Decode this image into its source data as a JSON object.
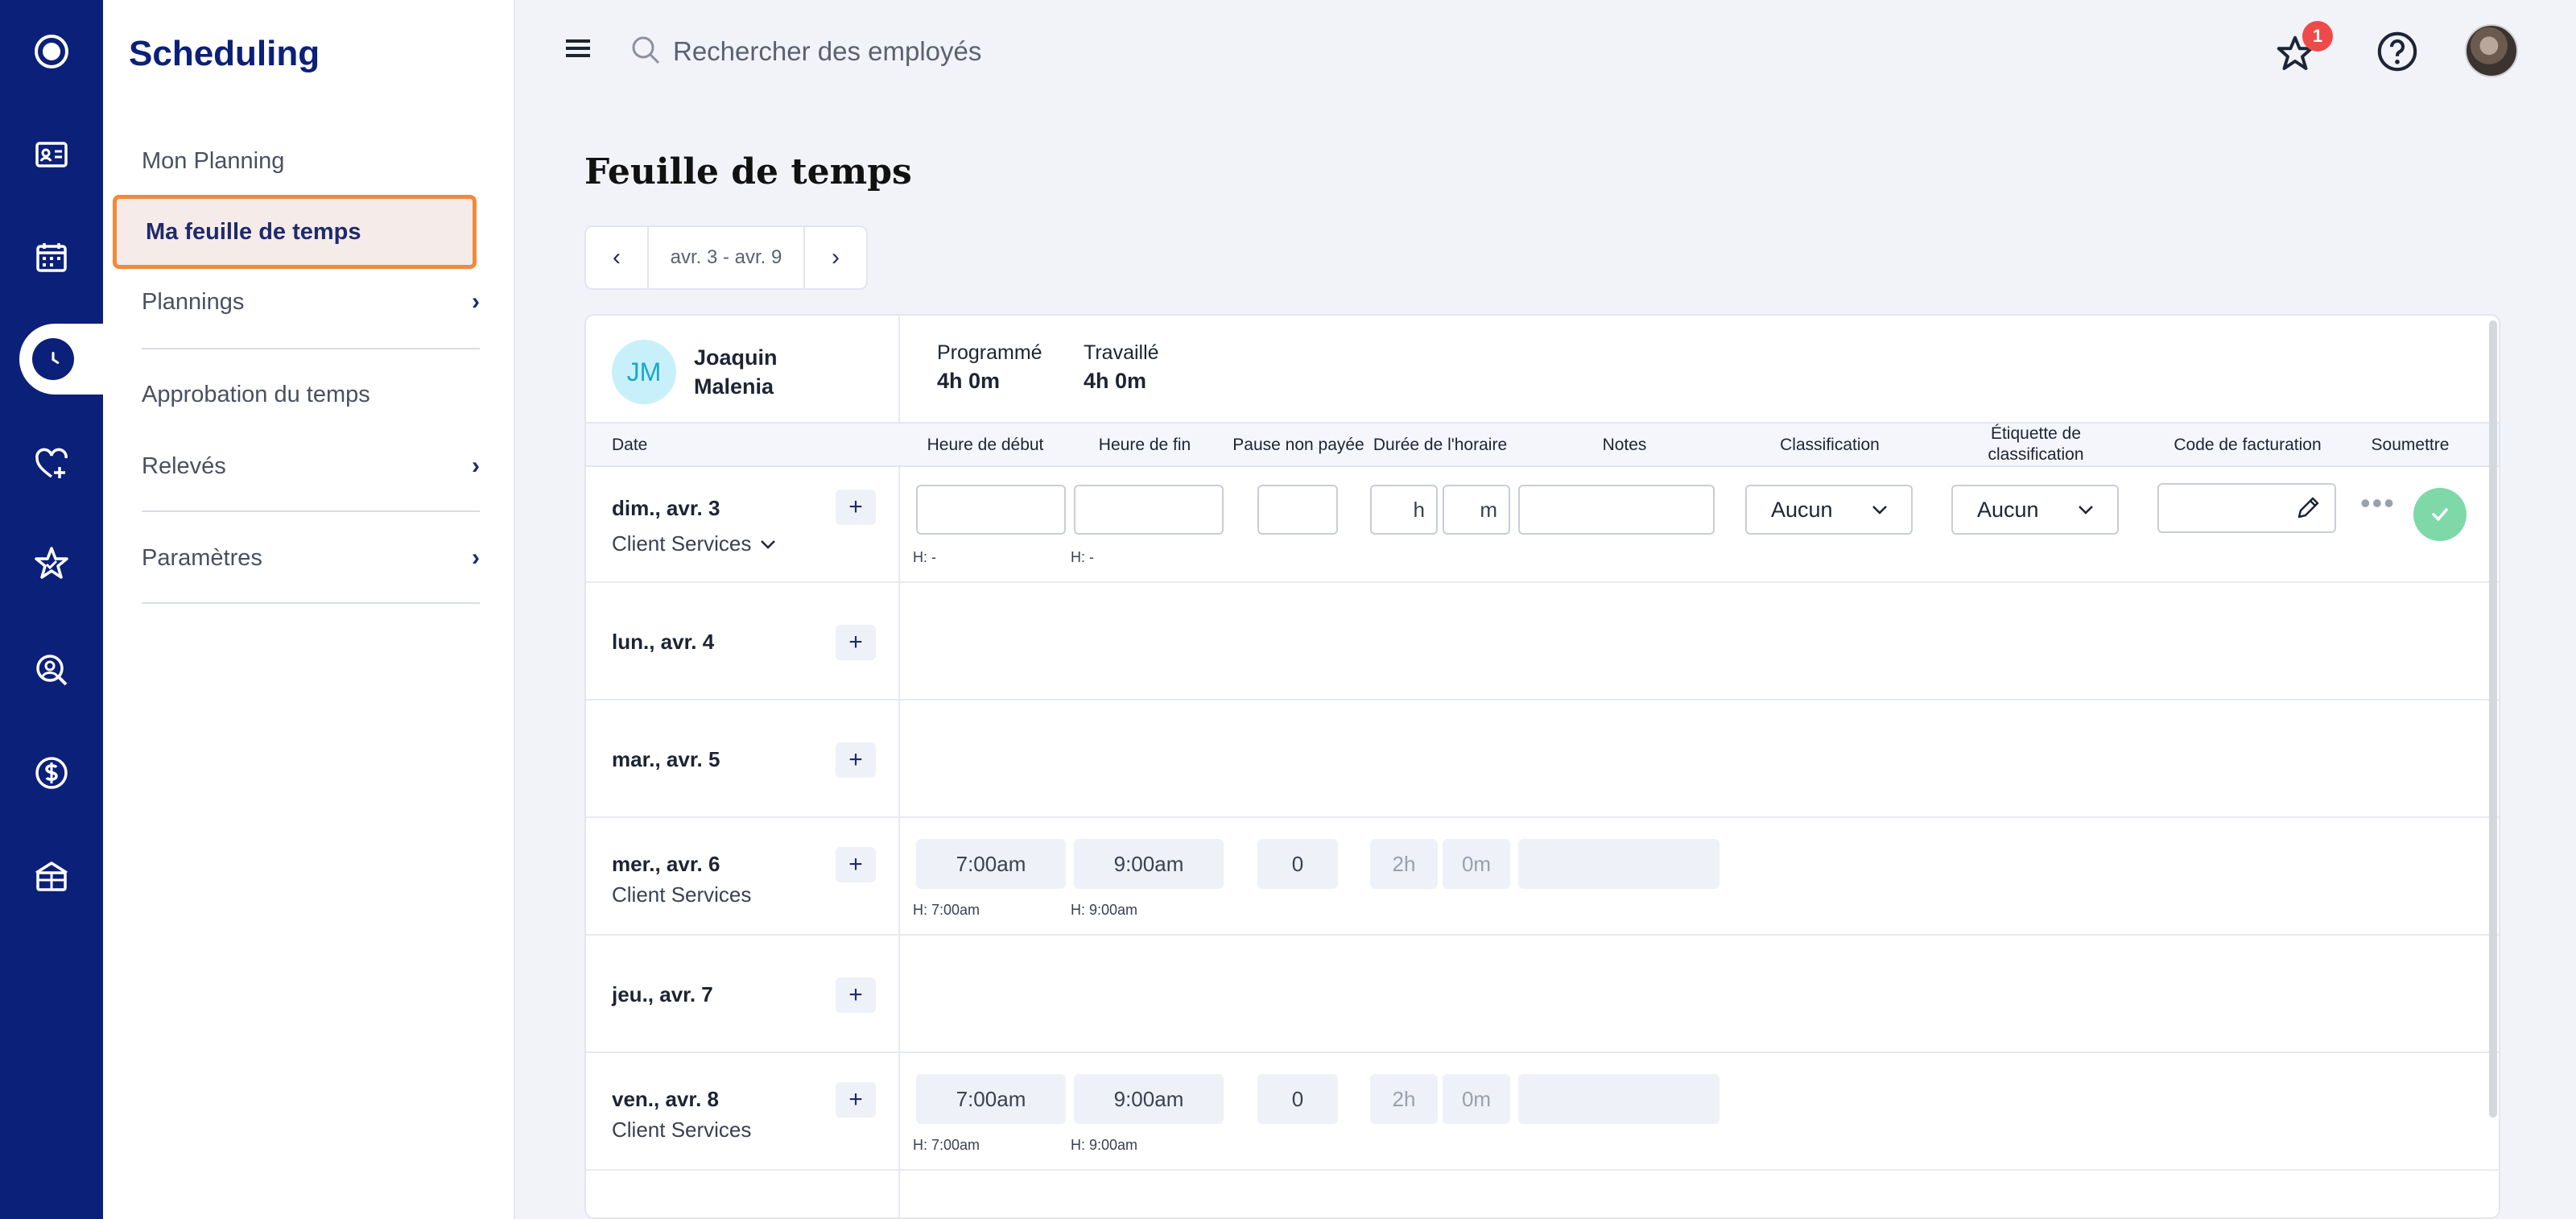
{
  "app": {
    "title": "Scheduling"
  },
  "nav": {
    "items": [
      {
        "label": "Mon Planning",
        "chevron": false,
        "active": false
      },
      {
        "label": "Ma feuille de temps",
        "chevron": false,
        "active": true
      },
      {
        "label": "Plannings",
        "chevron": true,
        "active": false
      },
      {
        "label": "Approbation du temps",
        "chevron": false,
        "active": false
      },
      {
        "label": "Relevés",
        "chevron": true,
        "active": false
      },
      {
        "label": "Paramètres",
        "chevron": true,
        "active": false
      }
    ]
  },
  "search": {
    "placeholder": "Rechercher des employés"
  },
  "notifications": {
    "count": "1"
  },
  "page": {
    "title": "Feuille de temps"
  },
  "week": {
    "range": "avr. 3 - avr. 9"
  },
  "employee": {
    "initials": "JM",
    "first_name": "Joaquin",
    "last_name": "Malenia",
    "scheduled_label": "Programmé",
    "scheduled_value": "4h 0m",
    "worked_label": "Travaillé",
    "worked_value": "4h 0m"
  },
  "columns": {
    "date": "Date",
    "start": "Heure de début",
    "end": "Heure de fin",
    "break": "Pause non payée",
    "duration": "Durée de l'horaire",
    "notes": "Notes",
    "classification": "Classification",
    "tag_line1": "Étiquette de",
    "tag_line2": "classification",
    "billing": "Code de facturation",
    "submit": "Soumettre"
  },
  "rows": [
    {
      "day": "dim., avr. 3",
      "department": "Client Services",
      "dept_dropdown": true,
      "editable": true,
      "hours_suffix": "h",
      "minutes_suffix": "m",
      "classification": "Aucun",
      "tag": "Aucun",
      "start_hint": "H: -",
      "end_hint": "H: -"
    },
    {
      "day": "lun., avr. 4"
    },
    {
      "day": "mar., avr. 5"
    },
    {
      "day": "mer., avr. 6",
      "department": "Client Services",
      "start": "7:00am",
      "end": "9:00am",
      "break": "0",
      "hours": "2h",
      "minutes": "0m",
      "start_hint": "H: 7:00am",
      "end_hint": "H: 9:00am"
    },
    {
      "day": "jeu., avr. 7"
    },
    {
      "day": "ven., avr. 8",
      "department": "Client Services",
      "start": "7:00am",
      "end": "9:00am",
      "break": "0",
      "hours": "2h",
      "minutes": "0m",
      "start_hint": "H: 7:00am",
      "end_hint": "H: 9:00am"
    }
  ],
  "colors": {
    "rail": "#0b2078",
    "active_border": "#f08a3c",
    "submit": "#7fd8a8",
    "badge": "#ef4a4a"
  }
}
